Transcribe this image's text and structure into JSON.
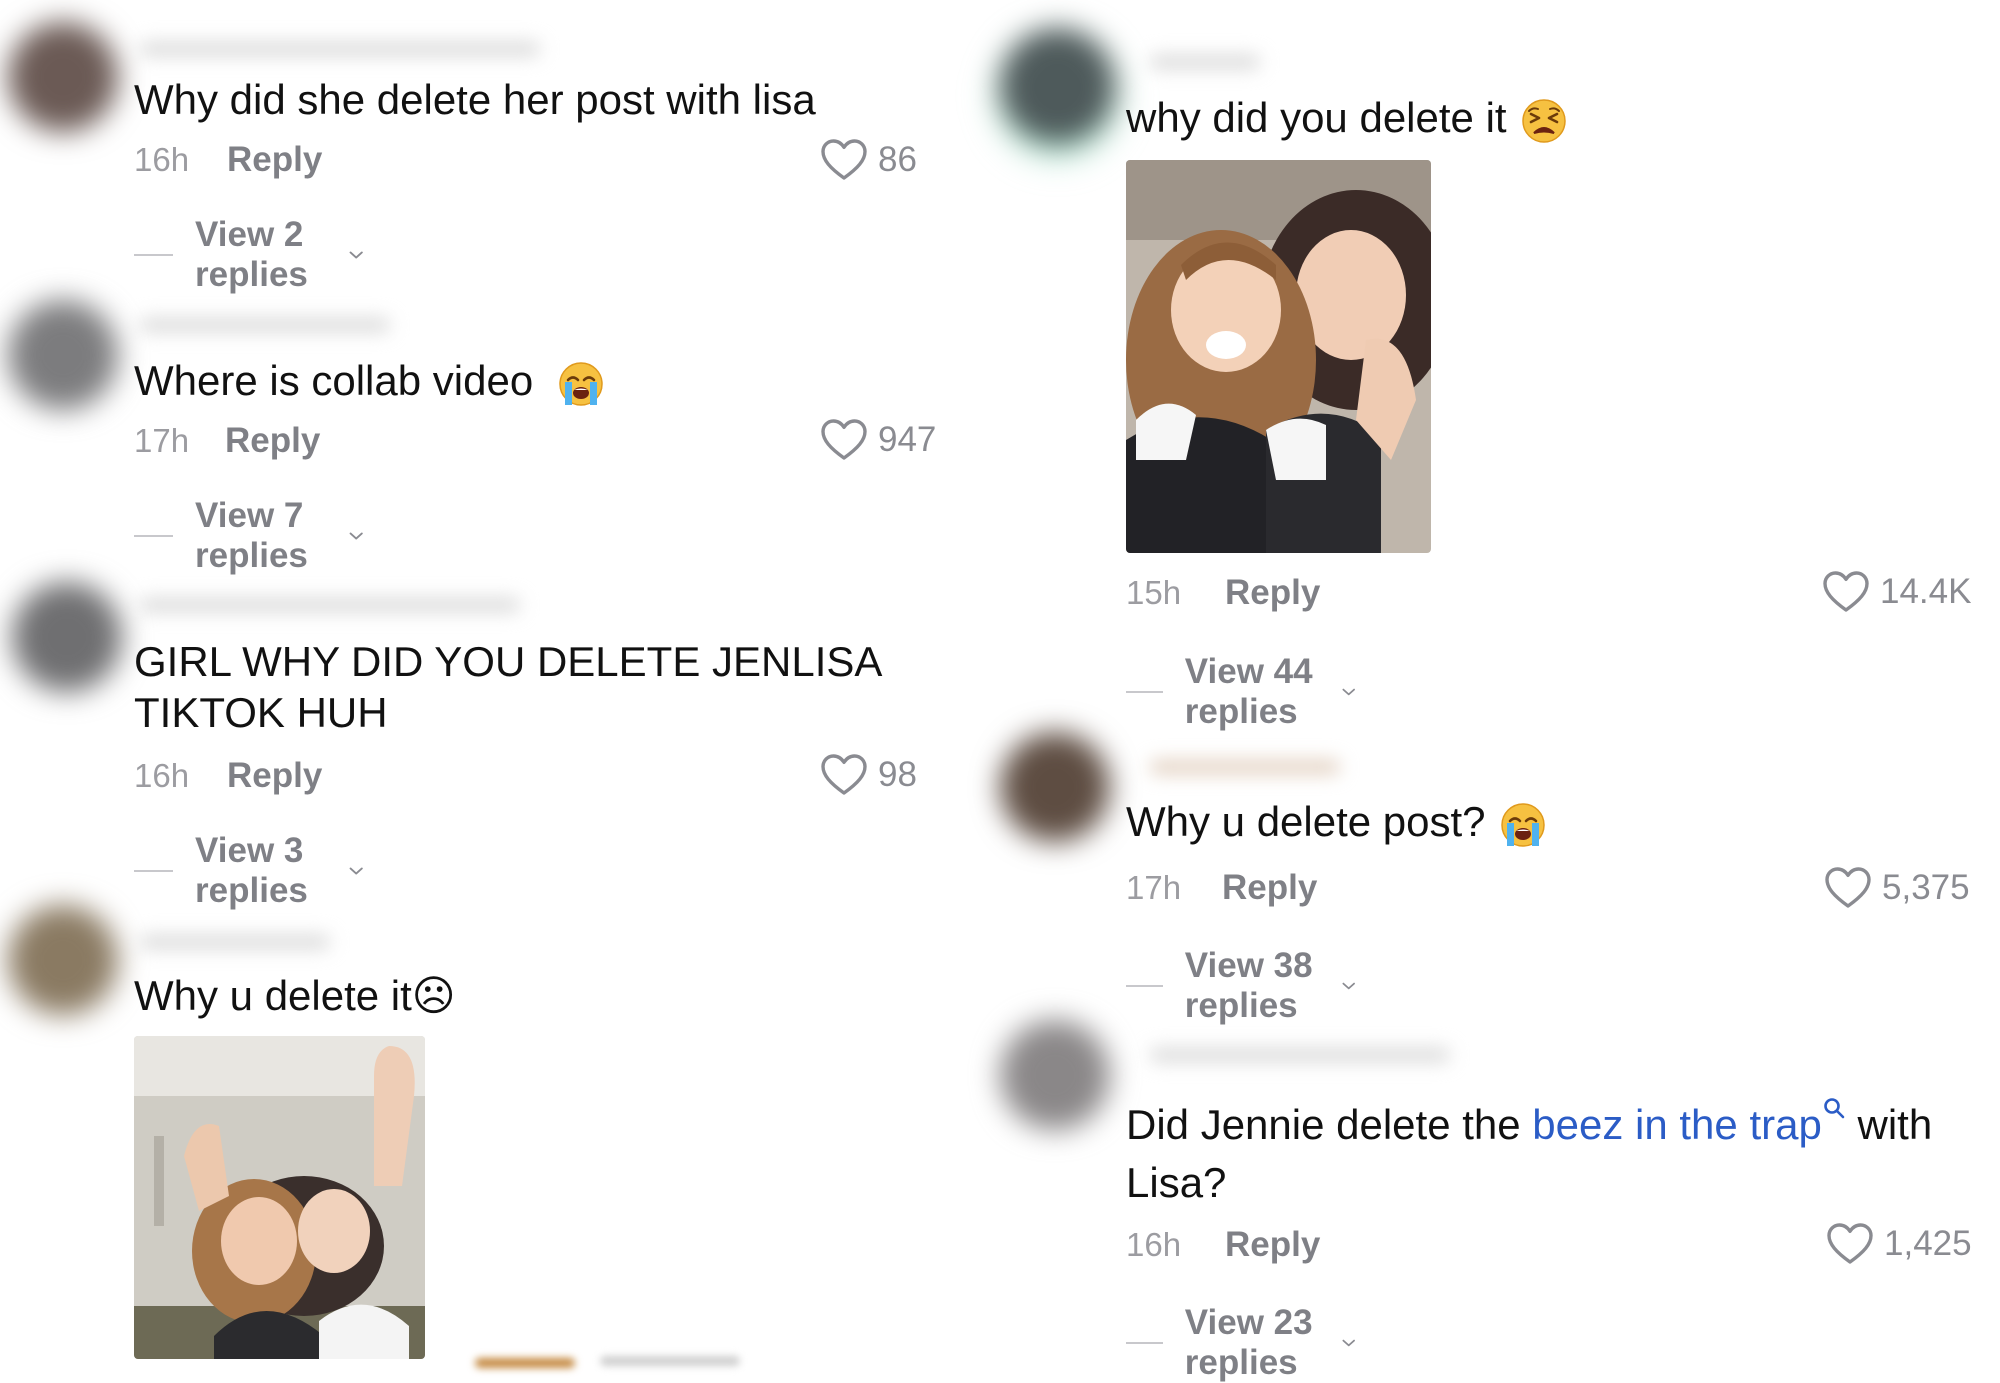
{
  "comments": [
    {
      "text": "Why did she delete her post with lisa",
      "time": "16h",
      "reply_label": "Reply",
      "likes": "86",
      "view_replies": "View 2 replies"
    },
    {
      "text": "Where is collab video",
      "emoji": "loudly-crying-face",
      "time": "17h",
      "reply_label": "Reply",
      "likes": "947",
      "view_replies": "View 7 replies"
    },
    {
      "text": "GIRL WHY DID YOU DELETE JENLISA TIKTOK HUH",
      "time": "16h",
      "reply_label": "Reply",
      "likes": "98",
      "view_replies": "View 3 replies"
    },
    {
      "text": "Why u delete it☹",
      "has_image": true
    },
    {
      "text": "why did you delete it",
      "emoji": "tired-face",
      "has_image": true,
      "time": "15h",
      "reply_label": "Reply",
      "likes": "14.4K",
      "view_replies": "View 44 replies"
    },
    {
      "text": "Why u delete post?",
      "emoji": "loudly-crying-face",
      "time": "17h",
      "reply_label": "Reply",
      "likes": "5,375",
      "view_replies": "View 38 replies"
    },
    {
      "text_before": "Did Jennie delete the ",
      "link": "beez in the trap",
      "text_after": " with Lisa?",
      "time": "16h",
      "reply_label": "Reply",
      "likes": "1,425",
      "view_replies": "View 23 replies"
    }
  ],
  "colors": {
    "text": "#111111",
    "meta": "#8a8b91",
    "link": "#2b5cc6"
  },
  "icons": [
    "heart-outline-icon",
    "chevron-down-icon",
    "search-icon"
  ]
}
